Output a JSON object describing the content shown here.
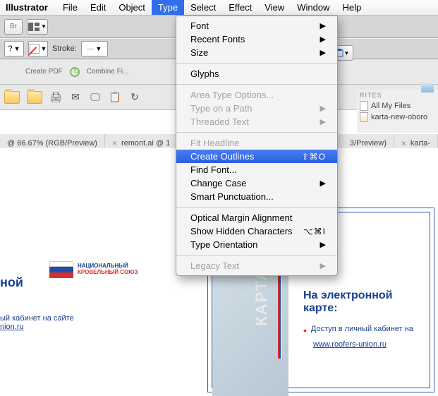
{
  "menubar": {
    "app": "Illustrator",
    "items": [
      "File",
      "Edit",
      "Object",
      "Type",
      "Select",
      "Effect",
      "View",
      "Window",
      "Help"
    ],
    "active_index": 3
  },
  "option_bar": {
    "br_label": "Br"
  },
  "control_bar": {
    "q_label": "?",
    "stroke_label": "Stroke:"
  },
  "favorites": {
    "header": "RITES",
    "row1": "All My Files",
    "row2": "karta-new-oboro"
  },
  "doc_tabs": {
    "left": "@ 66.67% (RGB/Preview)",
    "mid": "remont.ai @ 1",
    "r1": "3/Preview)",
    "r2": "karta-"
  },
  "dropdown": {
    "font": "Font",
    "recent_fonts": "Recent Fonts",
    "size": "Size",
    "glyphs": "Glyphs",
    "area_type": "Area Type Options...",
    "type_path": "Type on a Path",
    "threaded": "Threaded Text",
    "fit_headline": "Fit Headline",
    "create_outlines": "Create Outlines",
    "create_outlines_sc": "⇧⌘O",
    "find_font": "Find Font...",
    "change_case": "Change Case",
    "smart_punct": "Smart Punctuation...",
    "optical": "Optical Margin Alignment",
    "show_hidden": "Show Hidden Characters",
    "show_hidden_sc": "⌥⌘I",
    "type_orient": "Type Orientation",
    "legacy": "Legacy Text"
  },
  "artwork": {
    "logo_line1": "НАЦИОНАЛЬНЫЙ",
    "logo_line2": "КРОВЕЛЬНЫЙ СОЮЗ",
    "left_head": "ной",
    "left_sub1": "ый кабинет на сайте",
    "left_sub2": "nion.ru",
    "vert": "КАРТА",
    "right_head1": "На электронной",
    "right_head2": "карте:",
    "right_b1": "Доступ в личный кабинет на",
    "right_link": "www.roofers-union.ru"
  }
}
